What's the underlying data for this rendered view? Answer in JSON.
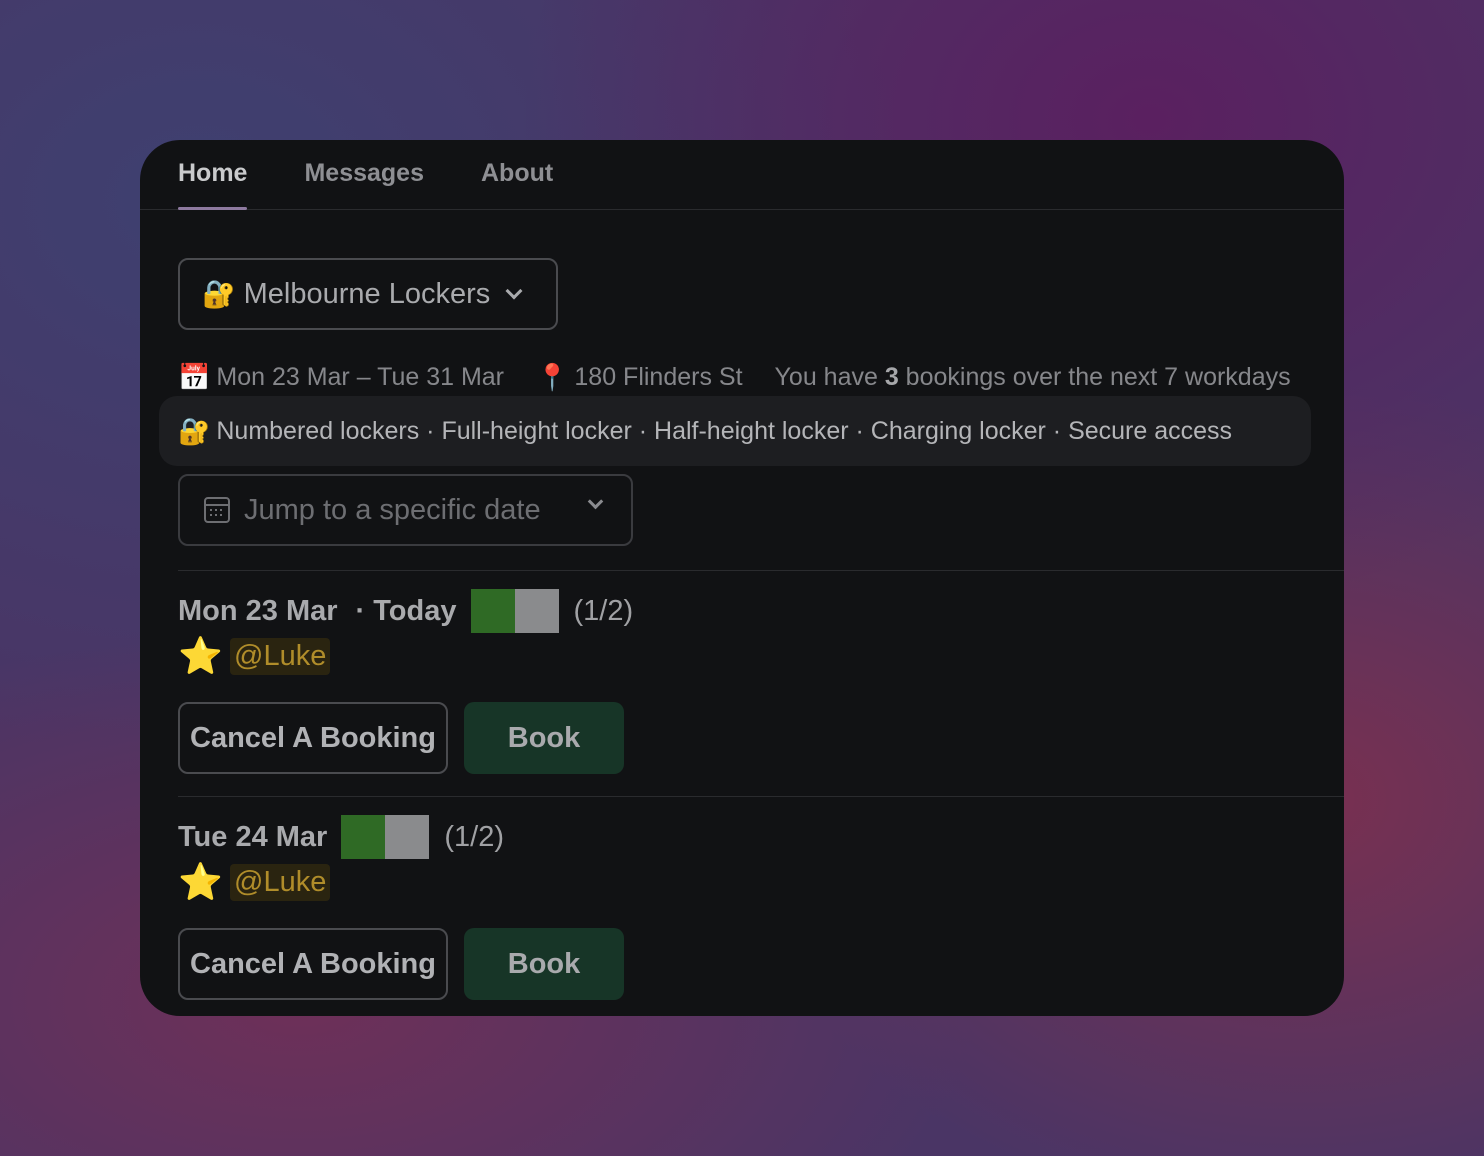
{
  "tabs": [
    {
      "label": "Home",
      "active": true
    },
    {
      "label": "Messages",
      "active": false
    },
    {
      "label": "About",
      "active": false
    }
  ],
  "location_select": {
    "emoji": "🔐",
    "label": "Melbourne Lockers"
  },
  "info": {
    "date_emoji": "📅",
    "date_range": "Mon 23 Mar – Tue 31 Mar",
    "pin_emoji": "📍",
    "address": "180 Flinders St",
    "bookings_prefix": "You have ",
    "bookings_count": "3",
    "bookings_suffix": " bookings over the next 7 workdays"
  },
  "features": {
    "emoji": "🔐",
    "text": "Numbered lockers · Full-height locker · Half-height locker · Charging locker · Secure access"
  },
  "date_select": {
    "placeholder": "Jump to a specific date"
  },
  "days": [
    {
      "date": "Mon 23 Mar",
      "today_label": "· Today",
      "count": "(1/2)",
      "user": "@Luke",
      "star": "⭐",
      "cancel_label": "Cancel A Booking",
      "book_label": "Book"
    },
    {
      "date": "Tue 24 Mar",
      "today_label": "",
      "count": "(1/2)",
      "user": "@Luke",
      "star": "⭐",
      "cancel_label": "Cancel A Booking",
      "book_label": "Book"
    }
  ],
  "colors": {
    "slot_taken": "#2f6a25",
    "slot_free": "#8a8b8d",
    "book_button": "#173527",
    "mention_text": "#b08d2a"
  }
}
